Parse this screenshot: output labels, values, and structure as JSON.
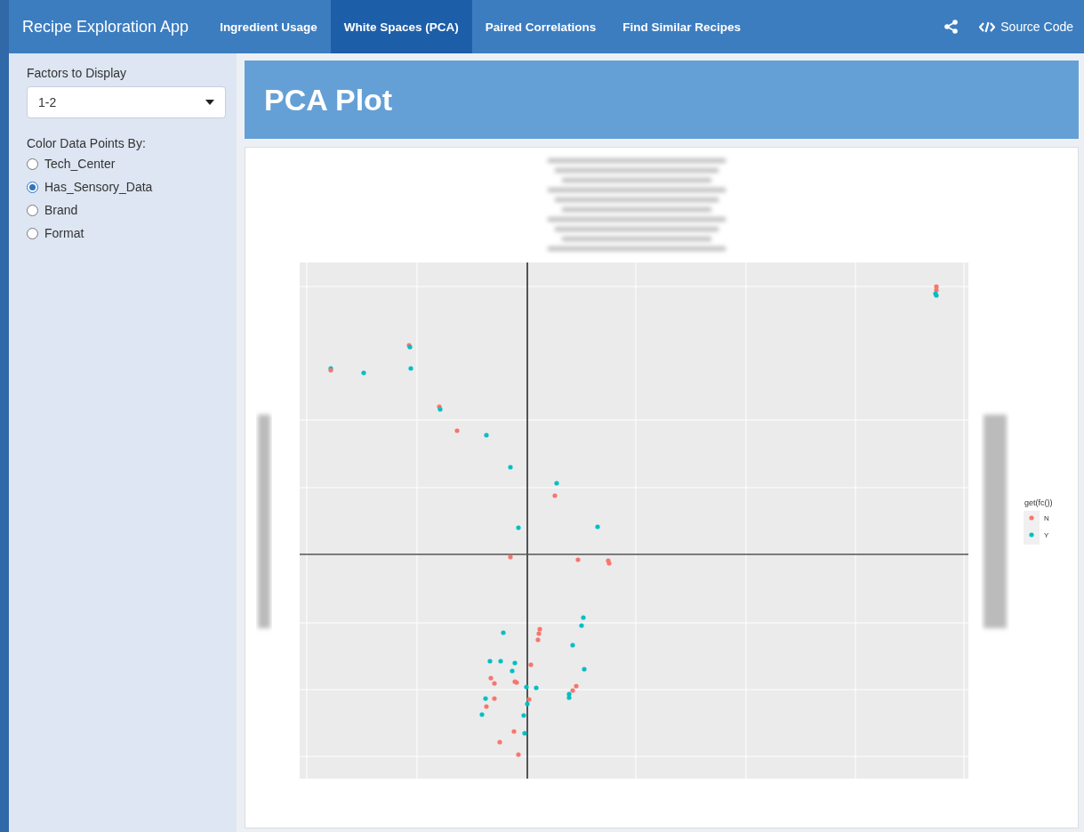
{
  "navbar": {
    "brand": "Recipe Exploration App",
    "tabs": [
      {
        "label": "Ingredient Usage",
        "selected": false
      },
      {
        "label": "White Spaces (PCA)",
        "selected": true
      },
      {
        "label": "Paired Correlations",
        "selected": false
      },
      {
        "label": "Find Similar Recipes",
        "selected": false
      }
    ],
    "source_link": "Source Code"
  },
  "sidebar": {
    "factors_label": "Factors to Display",
    "factors_value": "1-2",
    "color_label": "Color Data Points By:",
    "options": [
      {
        "label": "Tech_Center",
        "selected": false
      },
      {
        "label": "Has_Sensory_Data",
        "selected": true
      },
      {
        "label": "Brand",
        "selected": false
      },
      {
        "label": "Format",
        "selected": false
      }
    ]
  },
  "main": {
    "title": "PCA Plot",
    "plot": {
      "kind": "picture",
      "legend": {
        "title": "get(fc())",
        "items": [
          {
            "label": "N",
            "color": "#f8766d"
          },
          {
            "label": "Y",
            "color": "#00bfc4"
          }
        ]
      }
    }
  }
}
